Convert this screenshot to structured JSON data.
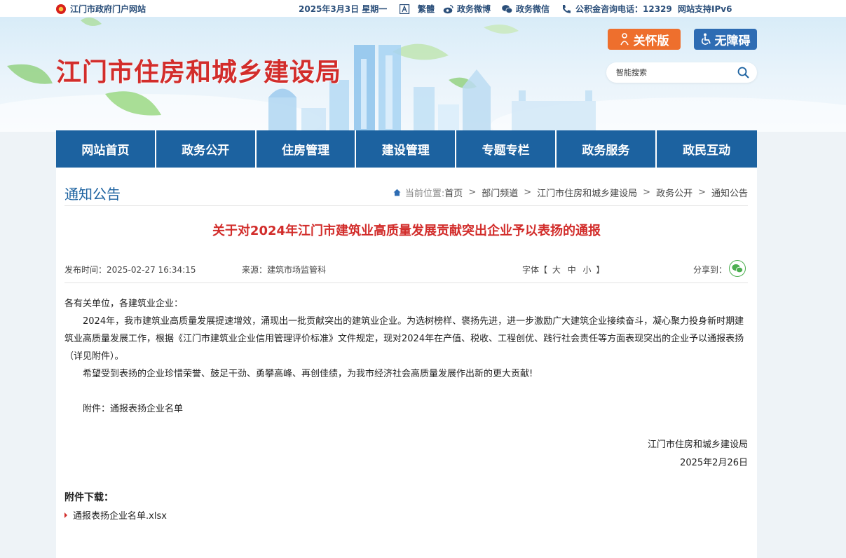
{
  "topbar": {
    "portal": "江门市政府门户网站",
    "date": "2025年3月3日 星期一",
    "traditional": "繁體",
    "weibo": "政务微博",
    "wechat": "政务微信",
    "hotline": "公积金咨询电话：12329",
    "ipv6": "网站支持IPv6"
  },
  "header": {
    "site_title": "江门市住房和城乡建设局",
    "care_label": "关怀版",
    "accessible_label": "无障碍",
    "search_placeholder": "智能搜索"
  },
  "nav": {
    "items": [
      "网站首页",
      "政务公开",
      "住房管理",
      "建设管理",
      "专题专栏",
      "政务服务",
      "政民互动"
    ]
  },
  "section": {
    "title": "通知公告"
  },
  "breadcrumb": {
    "prefix": "当前位置:",
    "items": [
      "首页",
      "部门频道",
      "江门市住房和城乡建设局",
      "政务公开",
      "通知公告"
    ]
  },
  "article": {
    "title": "关于对2024年江门市建筑业高质量发展贡献突出企业予以表扬的通报",
    "publish_time": "发布时间：2025-02-27 16:34:15",
    "source": "来源：建筑市场监管科",
    "font_label": "字体【",
    "font_large": "大",
    "font_medium": "中",
    "font_small": "小",
    "font_close": "】",
    "share_label": "分享到：",
    "greeting": "各有关单位，各建筑业企业：",
    "paragraph1": "2024年，我市建筑业高质量发展提速增效，涌现出一批贡献突出的建筑业企业。为选树榜样、褒扬先进，进一步激励广大建筑企业接续奋斗，凝心聚力投身新时期建筑业高质量发展工作，根据《江门市建筑业企业信用管理评价标准》文件规定，现对2024年在产值、税收、工程创优、践行社会责任等方面表现突出的企业予以通报表扬（详见附件）。",
    "paragraph2": "希望受到表扬的企业珍惜荣誉、鼓足干劲、勇攀高峰、再创佳绩，为我市经济社会高质量发展作出新的更大贡献!",
    "attachment_line": "附件：通报表扬企业名单",
    "signature_org": "江门市住房和城乡建设局",
    "signature_date": "2025年2月26日",
    "downloads_title": "附件下载：",
    "download_file": "通报表扬企业名单.xlsx"
  },
  "colors": {
    "brand_red": "#d22d2b",
    "nav_blue": "#1c62a0",
    "care_orange": "#ee6f2d",
    "access_blue": "#2e6cb3"
  }
}
